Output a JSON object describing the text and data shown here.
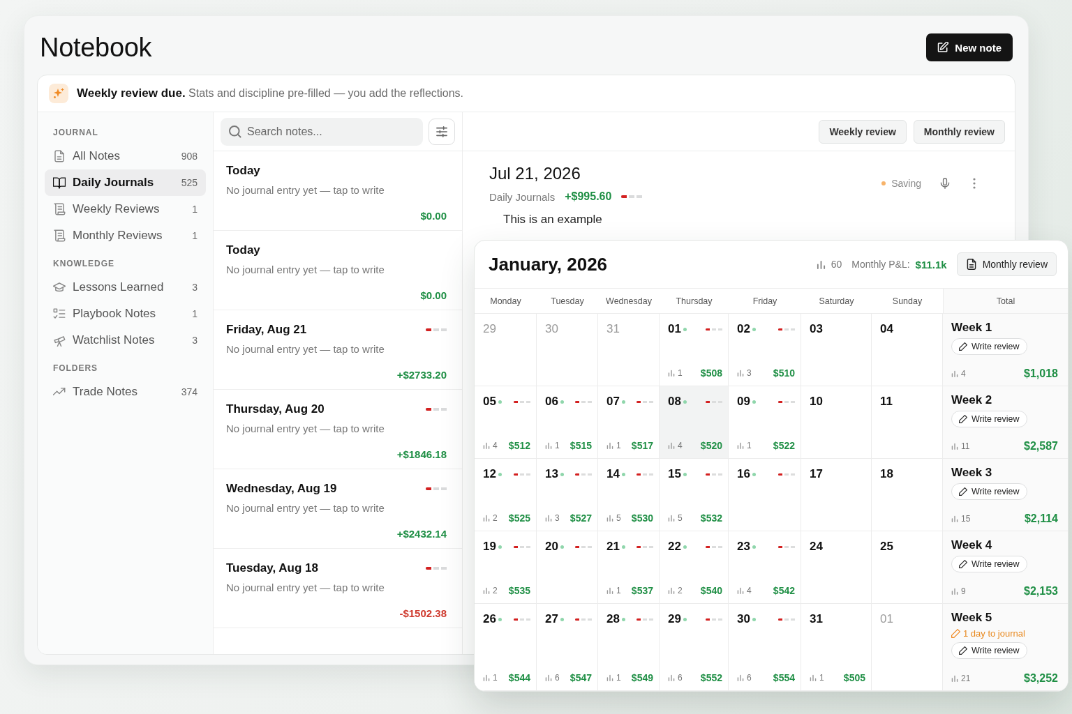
{
  "window": {
    "title": "Notebook"
  },
  "new_note_button": {
    "label": "New note"
  },
  "banner": {
    "text": "**Weekly review due.** Stats and discipline pre-filled — you add the reflections."
  },
  "sidebar": {
    "sections": [
      {
        "heading": "JOURNAL",
        "items": [
          {
            "label": "All Notes",
            "count": "908",
            "selected": false
          },
          {
            "label": "Daily Journals",
            "count": "525",
            "selected": true
          },
          {
            "label": "Weekly Reviews",
            "count": "1",
            "selected": false
          },
          {
            "label": "Monthly Reviews",
            "count": "1",
            "selected": false
          }
        ]
      },
      {
        "heading": "KNOWLEDGE",
        "items": [
          {
            "label": "Lessons Learned",
            "count": "3",
            "selected": false
          },
          {
            "label": "Playbook Notes",
            "count": "1",
            "selected": false
          },
          {
            "label": "Watchlist Notes",
            "count": "3",
            "selected": false
          }
        ]
      },
      {
        "heading": "FOLDERS",
        "items": [
          {
            "label": "Trade Notes",
            "count": "374",
            "selected": false
          }
        ]
      }
    ]
  },
  "note_list": {
    "search": {
      "placeholder": "Search notes..."
    },
    "notes": [
      {
        "title": "Today",
        "preview": "No journal entry yet — tap to write",
        "amount": "$0.00",
        "negative": false
      },
      {
        "title": "Today",
        "preview": "No journal entry yet — tap to write",
        "amount": "$0.00",
        "negative": false
      },
      {
        "title": "Friday, Aug 21",
        "preview": "No journal entry yet — tap to write",
        "amount": "+$2733.20",
        "negative": false,
        "discipline": {
          "level": 0.33
        }
      },
      {
        "title": "Thursday, Aug 20",
        "preview": "No journal entry yet — tap to write",
        "amount": "+$1846.18",
        "negative": false,
        "discipline": {
          "level": 0.33
        }
      },
      {
        "title": "Wednesday, Aug 19",
        "preview": "No journal entry yet — tap to write",
        "amount": "+$2432.14",
        "negative": false,
        "discipline": {
          "level": 0.33
        }
      },
      {
        "title": "Tuesday, Aug 18",
        "preview": "No journal entry yet — tap to write",
        "amount": "-$1502.38",
        "negative": true,
        "discipline": {
          "level": 0.33
        }
      }
    ]
  },
  "editor": {
    "actions": [
      "Weekly review",
      "Monthly review"
    ],
    "title": "Jul 21, 2026",
    "category": "Daily Journals",
    "pnl": "+$995.60",
    "discipline": {
      "level": 0.33
    },
    "status": "Saving",
    "body": "This is an example"
  },
  "calendar": {
    "title": "January, 2026",
    "trade_count": "60",
    "pnl_label": "Monthly P&L:",
    "pnl": "$11.1k",
    "review_button": "Monthly review",
    "columns": [
      "Monday",
      "Tuesday",
      "Wednesday",
      "Thursday",
      "Friday",
      "Saturday",
      "Sunday",
      "Total"
    ],
    "weeks": [
      {
        "days": [
          {
            "day": "29",
            "muted": true,
            "selected": false,
            "dot": false
          },
          {
            "day": "30",
            "muted": true,
            "selected": false,
            "dot": false
          },
          {
            "day": "31",
            "muted": true,
            "selected": false,
            "dot": false
          },
          {
            "day": "01",
            "muted": false,
            "selected": false,
            "dot": true,
            "discipline": {
              "level": 0.33
            },
            "trades": "1",
            "pnl": "$508"
          },
          {
            "day": "02",
            "muted": false,
            "selected": false,
            "dot": true,
            "discipline": {
              "level": 0.33
            },
            "trades": "3",
            "pnl": "$510"
          },
          {
            "day": "03",
            "muted": false,
            "selected": false,
            "dot": false
          },
          {
            "day": "04",
            "muted": false,
            "selected": false,
            "dot": false
          }
        ],
        "total": {
          "label": "Week 1",
          "button": "Write review",
          "trades": "4",
          "pnl": "$1,018"
        }
      },
      {
        "days": [
          {
            "day": "05",
            "muted": false,
            "selected": false,
            "dot": true,
            "discipline": {
              "level": 0.33
            },
            "trades": "4",
            "pnl": "$512"
          },
          {
            "day": "06",
            "muted": false,
            "selected": false,
            "dot": true,
            "discipline": {
              "level": 0.33
            },
            "trades": "1",
            "pnl": "$515"
          },
          {
            "day": "07",
            "muted": false,
            "selected": false,
            "dot": true,
            "discipline": {
              "level": 0.33
            },
            "trades": "1",
            "pnl": "$517"
          },
          {
            "day": "08",
            "muted": false,
            "selected": true,
            "dot": true,
            "discipline": {
              "level": 0.33
            },
            "trades": "4",
            "pnl": "$520"
          },
          {
            "day": "09",
            "muted": false,
            "selected": false,
            "dot": true,
            "discipline": {
              "level": 0.33
            },
            "trades": "1",
            "pnl": "$522"
          },
          {
            "day": "10",
            "muted": false,
            "selected": false,
            "dot": false
          },
          {
            "day": "11",
            "muted": false,
            "selected": false,
            "dot": false
          }
        ],
        "total": {
          "label": "Week 2",
          "button": "Write review",
          "trades": "11",
          "pnl": "$2,587"
        }
      },
      {
        "days": [
          {
            "day": "12",
            "muted": false,
            "selected": false,
            "dot": true,
            "discipline": {
              "level": 0.33
            },
            "trades": "2",
            "pnl": "$525"
          },
          {
            "day": "13",
            "muted": false,
            "selected": false,
            "dot": true,
            "discipline": {
              "level": 0.33
            },
            "trades": "3",
            "pnl": "$527"
          },
          {
            "day": "14",
            "muted": false,
            "selected": false,
            "dot": true,
            "discipline": {
              "level": 0.33
            },
            "trades": "5",
            "pnl": "$530"
          },
          {
            "day": "15",
            "muted": false,
            "selected": false,
            "dot": true,
            "discipline": {
              "level": 0.33
            },
            "trades": "5",
            "pnl": "$532"
          },
          {
            "day": "16",
            "muted": false,
            "selected": false,
            "dot": true,
            "discipline": {
              "level": 0.33
            }
          },
          {
            "day": "17",
            "muted": false,
            "selected": false,
            "dot": false
          },
          {
            "day": "18",
            "muted": false,
            "selected": false,
            "dot": false
          }
        ],
        "total": {
          "label": "Week 3",
          "button": "Write review",
          "trades": "15",
          "pnl": "$2,114"
        }
      },
      {
        "days": [
          {
            "day": "19",
            "muted": false,
            "selected": false,
            "dot": true,
            "discipline": {
              "level": 0.33
            },
            "trades": "2",
            "pnl": "$535"
          },
          {
            "day": "20",
            "muted": false,
            "selected": false,
            "dot": true,
            "discipline": {
              "level": 0.33
            }
          },
          {
            "day": "21",
            "muted": false,
            "selected": false,
            "dot": true,
            "discipline": {
              "level": 0.33
            },
            "trades": "1",
            "pnl": "$537"
          },
          {
            "day": "22",
            "muted": false,
            "selected": false,
            "dot": true,
            "discipline": {
              "level": 0.33
            },
            "trades": "2",
            "pnl": "$540"
          },
          {
            "day": "23",
            "muted": false,
            "selected": false,
            "dot": true,
            "discipline": {
              "level": 0.33
            },
            "trades": "4",
            "pnl": "$542"
          },
          {
            "day": "24",
            "muted": false,
            "selected": false,
            "dot": false
          },
          {
            "day": "25",
            "muted": false,
            "selected": false,
            "dot": false
          }
        ],
        "total": {
          "label": "Week 4",
          "button": "Write review",
          "trades": "9",
          "pnl": "$2,153"
        }
      },
      {
        "days": [
          {
            "day": "26",
            "muted": false,
            "selected": false,
            "dot": true,
            "discipline": {
              "level": 0.33
            },
            "trades": "1",
            "pnl": "$544"
          },
          {
            "day": "27",
            "muted": false,
            "selected": false,
            "dot": true,
            "discipline": {
              "level": 0.33
            },
            "trades": "6",
            "pnl": "$547"
          },
          {
            "day": "28",
            "muted": false,
            "selected": false,
            "dot": true,
            "discipline": {
              "level": 0.33
            },
            "trades": "1",
            "pnl": "$549"
          },
          {
            "day": "29",
            "muted": false,
            "selected": false,
            "dot": true,
            "discipline": {
              "level": 0.33
            },
            "trades": "6",
            "pnl": "$552"
          },
          {
            "day": "30",
            "muted": false,
            "selected": false,
            "dot": true,
            "discipline": {
              "level": 0.33
            },
            "trades": "6",
            "pnl": "$554"
          },
          {
            "day": "31",
            "muted": false,
            "selected": false,
            "dot": false,
            "trades": "1",
            "pnl": "$505"
          },
          {
            "day": "01",
            "muted": true,
            "selected": false,
            "dot": false
          }
        ],
        "total": {
          "label": "Week 5",
          "reminder": "1 day to journal",
          "button": "Write review",
          "trades": "21",
          "pnl": "$3,252"
        }
      }
    ]
  }
}
